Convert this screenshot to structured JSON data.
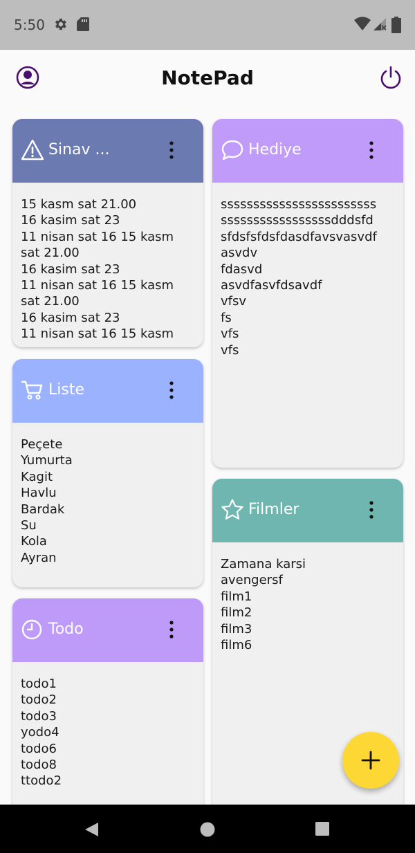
{
  "status_bar": {
    "time": "5:50",
    "icons": [
      "gear-icon",
      "sd-card-icon",
      "wifi-icon",
      "signal-icon",
      "battery-icon"
    ]
  },
  "app_bar": {
    "title": "NotePad",
    "left_icon": "account-icon",
    "right_icon": "power-icon"
  },
  "colors": {
    "accent": "#4a0e6e",
    "sinav": "#6b7ab0",
    "hediye": "#c19bf9",
    "liste": "#9ab2ff",
    "filmler": "#6fb6b0",
    "todo": "#bf9bf9",
    "fab": "#fdd835"
  },
  "notes": [
    {
      "id": "sinav",
      "title": "Sinav ...",
      "icon": "warning-icon",
      "lines": [
        "15 kasm sat 21.00",
        "16 kasim sat 23",
        "11 nisan sat 16 15 kasm",
        "sat 21.00",
        "16 kasim sat 23",
        "11 nisan sat 16 15 kasm",
        "sat 21.00",
        "16 kasim sat 23",
        "11 nisan sat 16 15 kasm"
      ]
    },
    {
      "id": "liste",
      "title": "Liste",
      "icon": "cart-icon",
      "lines": [
        "Peçete",
        "Yumurta",
        "Kagit",
        "Havlu",
        "Bardak",
        "Su",
        "Kola",
        "Ayran"
      ]
    },
    {
      "id": "todo",
      "title": "Todo",
      "icon": "clock-icon",
      "lines": [
        "todo1",
        "todo2",
        "todo3",
        "yodo4",
        "todo6",
        "todo8",
        "ttodo2"
      ]
    },
    {
      "id": "hediye",
      "title": "Hediye",
      "icon": "chat-bubble-icon",
      "lines": [
        "ssssssssssssssssssssssss",
        "sssssssssssssssssdddsfd",
        "sfdsfsfdsfdasdfavsvasvdf",
        "asvdv",
        "fdasvd",
        "asvdfasvfdsavdf",
        "vfsv",
        "fs",
        "vfs",
        "vfs"
      ]
    },
    {
      "id": "filmler",
      "title": "Filmler",
      "icon": "star-icon",
      "lines": [
        "Zamana karsi",
        "avengersf",
        "film1",
        "film2",
        "film3",
        "film6"
      ]
    }
  ],
  "fab": {
    "icon": "plus-icon"
  },
  "nav_bar": {
    "icons": [
      "back-icon",
      "home-icon",
      "recents-icon"
    ]
  }
}
